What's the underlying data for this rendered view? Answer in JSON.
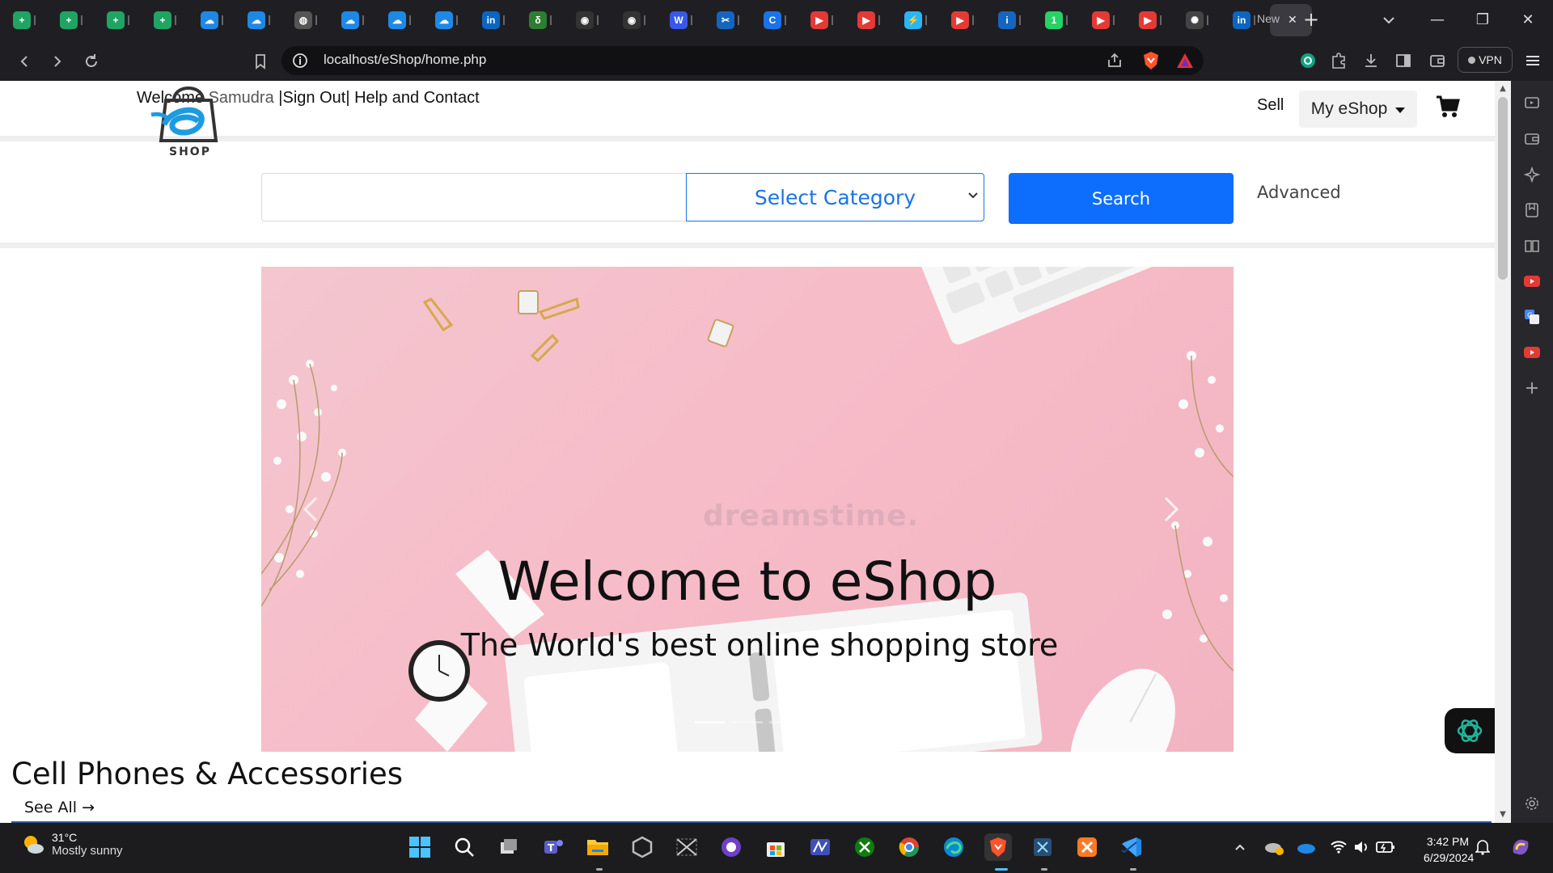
{
  "browser": {
    "tabs_new_label": "New",
    "url": "localhost/eShop/home.php",
    "vpn_label": "VPN",
    "tabs": [
      {
        "icon": "sheets-icon",
        "color": "#1fa463",
        "glyph": "+"
      },
      {
        "icon": "sheets-icon",
        "color": "#1fa463",
        "glyph": "+"
      },
      {
        "icon": "sheets-icon",
        "color": "#1fa463",
        "glyph": "+"
      },
      {
        "icon": "sheets-icon",
        "color": "#1fa463",
        "glyph": "+"
      },
      {
        "icon": "onedrive-icon",
        "color": "#1e88e5",
        "glyph": "☁"
      },
      {
        "icon": "onedrive-icon",
        "color": "#1e88e5",
        "glyph": "☁"
      },
      {
        "icon": "globe-icon",
        "color": "#555555",
        "glyph": "◍"
      },
      {
        "icon": "onedrive-icon",
        "color": "#1e88e5",
        "glyph": "☁"
      },
      {
        "icon": "onedrive-icon",
        "color": "#1e88e5",
        "glyph": "☁"
      },
      {
        "icon": "onedrive-icon",
        "color": "#1e88e5",
        "glyph": "☁"
      },
      {
        "icon": "linkedin-icon",
        "color": "#0a66c2",
        "glyph": "in"
      },
      {
        "icon": "leaf-icon",
        "color": "#2e7d32",
        "glyph": "δ"
      },
      {
        "icon": "github-icon",
        "color": "#333333",
        "glyph": "◉"
      },
      {
        "icon": "github-icon",
        "color": "#333333",
        "glyph": "◉"
      },
      {
        "icon": "wordpress-icon",
        "color": "#3858e9",
        "glyph": "W"
      },
      {
        "icon": "tools-icon",
        "color": "#1565c0",
        "glyph": "✂"
      },
      {
        "icon": "c-icon",
        "color": "#1a73e8",
        "glyph": "C"
      },
      {
        "icon": "youtube-icon",
        "color": "#e53935",
        "glyph": "▶"
      },
      {
        "icon": "youtube-icon",
        "color": "#e53935",
        "glyph": "▶"
      },
      {
        "icon": "flutter-icon",
        "color": "#29b6f6",
        "glyph": "⚡"
      },
      {
        "icon": "youtube-icon",
        "color": "#e53935",
        "glyph": "▶"
      },
      {
        "icon": "info-icon",
        "color": "#1565c0",
        "glyph": "i"
      },
      {
        "icon": "whatsapp-icon",
        "color": "#25d366",
        "glyph": "1"
      },
      {
        "icon": "youtube-icon",
        "color": "#e53935",
        "glyph": "▶"
      },
      {
        "icon": "youtube-icon",
        "color": "#e53935",
        "glyph": "▶"
      },
      {
        "icon": "chatgpt-icon",
        "color": "#444444",
        "glyph": "✺"
      },
      {
        "icon": "linkedin-icon",
        "color": "#0a66c2",
        "glyph": "in"
      }
    ]
  },
  "header": {
    "welcome_prefix": "Welcome",
    "username": "Samudra",
    "sep1": "|",
    "sign_out": "Sign Out",
    "sep2": "|",
    "help": "Help and Contact",
    "sell": "Sell",
    "my_eshop": "My eShop"
  },
  "search": {
    "logo_text": "SHOP",
    "placeholder": "",
    "category_selected": "Select Category",
    "button": "Search",
    "advanced": "Advanced"
  },
  "carousel": {
    "title": "Welcome to eShop",
    "subtitle": "The World's best online shopping store",
    "watermark": "dreamstime."
  },
  "section": {
    "title": "Cell Phones & Accessories",
    "see_all": "See All →"
  },
  "taskbar": {
    "temp": "31°C",
    "condition": "Mostly sunny",
    "time": "3:42 PM",
    "date": "6/29/2024"
  }
}
